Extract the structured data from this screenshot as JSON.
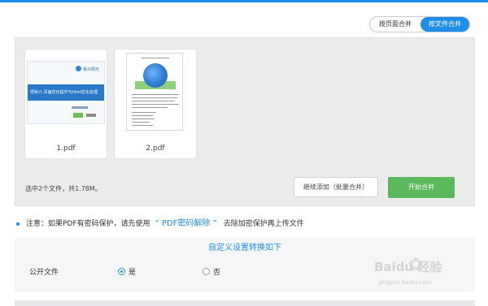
{
  "mode_toggle": {
    "by_page_label": "按页面合并",
    "by_file_label": "按文件合并"
  },
  "files": [
    {
      "name": "1.pdf",
      "thumbnail_type": "slide",
      "slide_title": "项目六  页面优化提升与html优化处理",
      "slide_logo": "易众阳光"
    },
    {
      "name": "2.pdf",
      "thumbnail_type": "document"
    }
  ],
  "status": {
    "summary": "选中2个文件，共1.78M。"
  },
  "actions": {
    "add_more_label": "继续添加（批量合并）",
    "start_merge_label": "开始合并"
  },
  "note": {
    "prefix": "注意：如果PDF有密码保护，请先使用",
    "link_label": "“ PDF密码解除 ”",
    "suffix": "去除加密保护再上传文件"
  },
  "settings": {
    "title": "自定义设置转换如下",
    "public_file_label": "公开文件",
    "option_yes": "是",
    "option_no": "否",
    "selected": "yes"
  },
  "watermark": {
    "brand": "Baidu 经验",
    "url": "jingyan.baidu.com"
  },
  "colors": {
    "accent": "#1e8ee8",
    "merge_button": "#5cb85c",
    "panel_bg": "#ececec"
  }
}
